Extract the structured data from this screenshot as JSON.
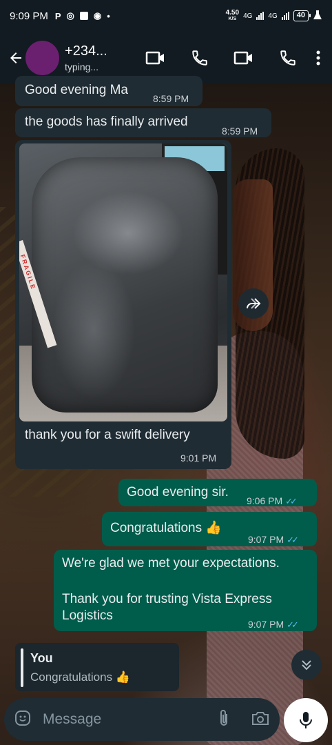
{
  "status_bar": {
    "time": "9:09 PM",
    "speed_value": "4.50",
    "speed_unit": "K/S",
    "network_1": "4G",
    "network_2": "4G",
    "battery": "40"
  },
  "header": {
    "contact_name": "+234...",
    "contact_status": "typing..."
  },
  "messages": [
    {
      "direction": "in",
      "text": "Good evening Ma",
      "time": "8:59 PM"
    },
    {
      "direction": "in",
      "text": "the goods has finally arrived",
      "time": "8:59 PM"
    },
    {
      "direction": "in",
      "type": "image",
      "caption": "thank you for a swift delivery",
      "time": "9:01 PM",
      "photo_label": "FRAGILE"
    },
    {
      "direction": "out",
      "text": "Good evening sir.",
      "time": "9:06 PM",
      "status": "read"
    },
    {
      "direction": "out",
      "text": "Congratulations 👍",
      "time": "9:07 PM",
      "status": "read"
    },
    {
      "direction": "out",
      "text_line1": "We're glad we met your expectations.",
      "text_line2": "Thank you for trusting Vista Express",
      "text_line3": "Logistics",
      "time": "9:07 PM",
      "status": "read"
    }
  ],
  "reply_preview": {
    "author": "You",
    "text": "Congratulations 👍"
  },
  "composer": {
    "placeholder": "Message"
  },
  "colors": {
    "header_bg": "#111b21",
    "incoming_bubble": "#202c33",
    "outgoing_bubble": "#005c4b",
    "read_ticks": "#53bdeb"
  }
}
